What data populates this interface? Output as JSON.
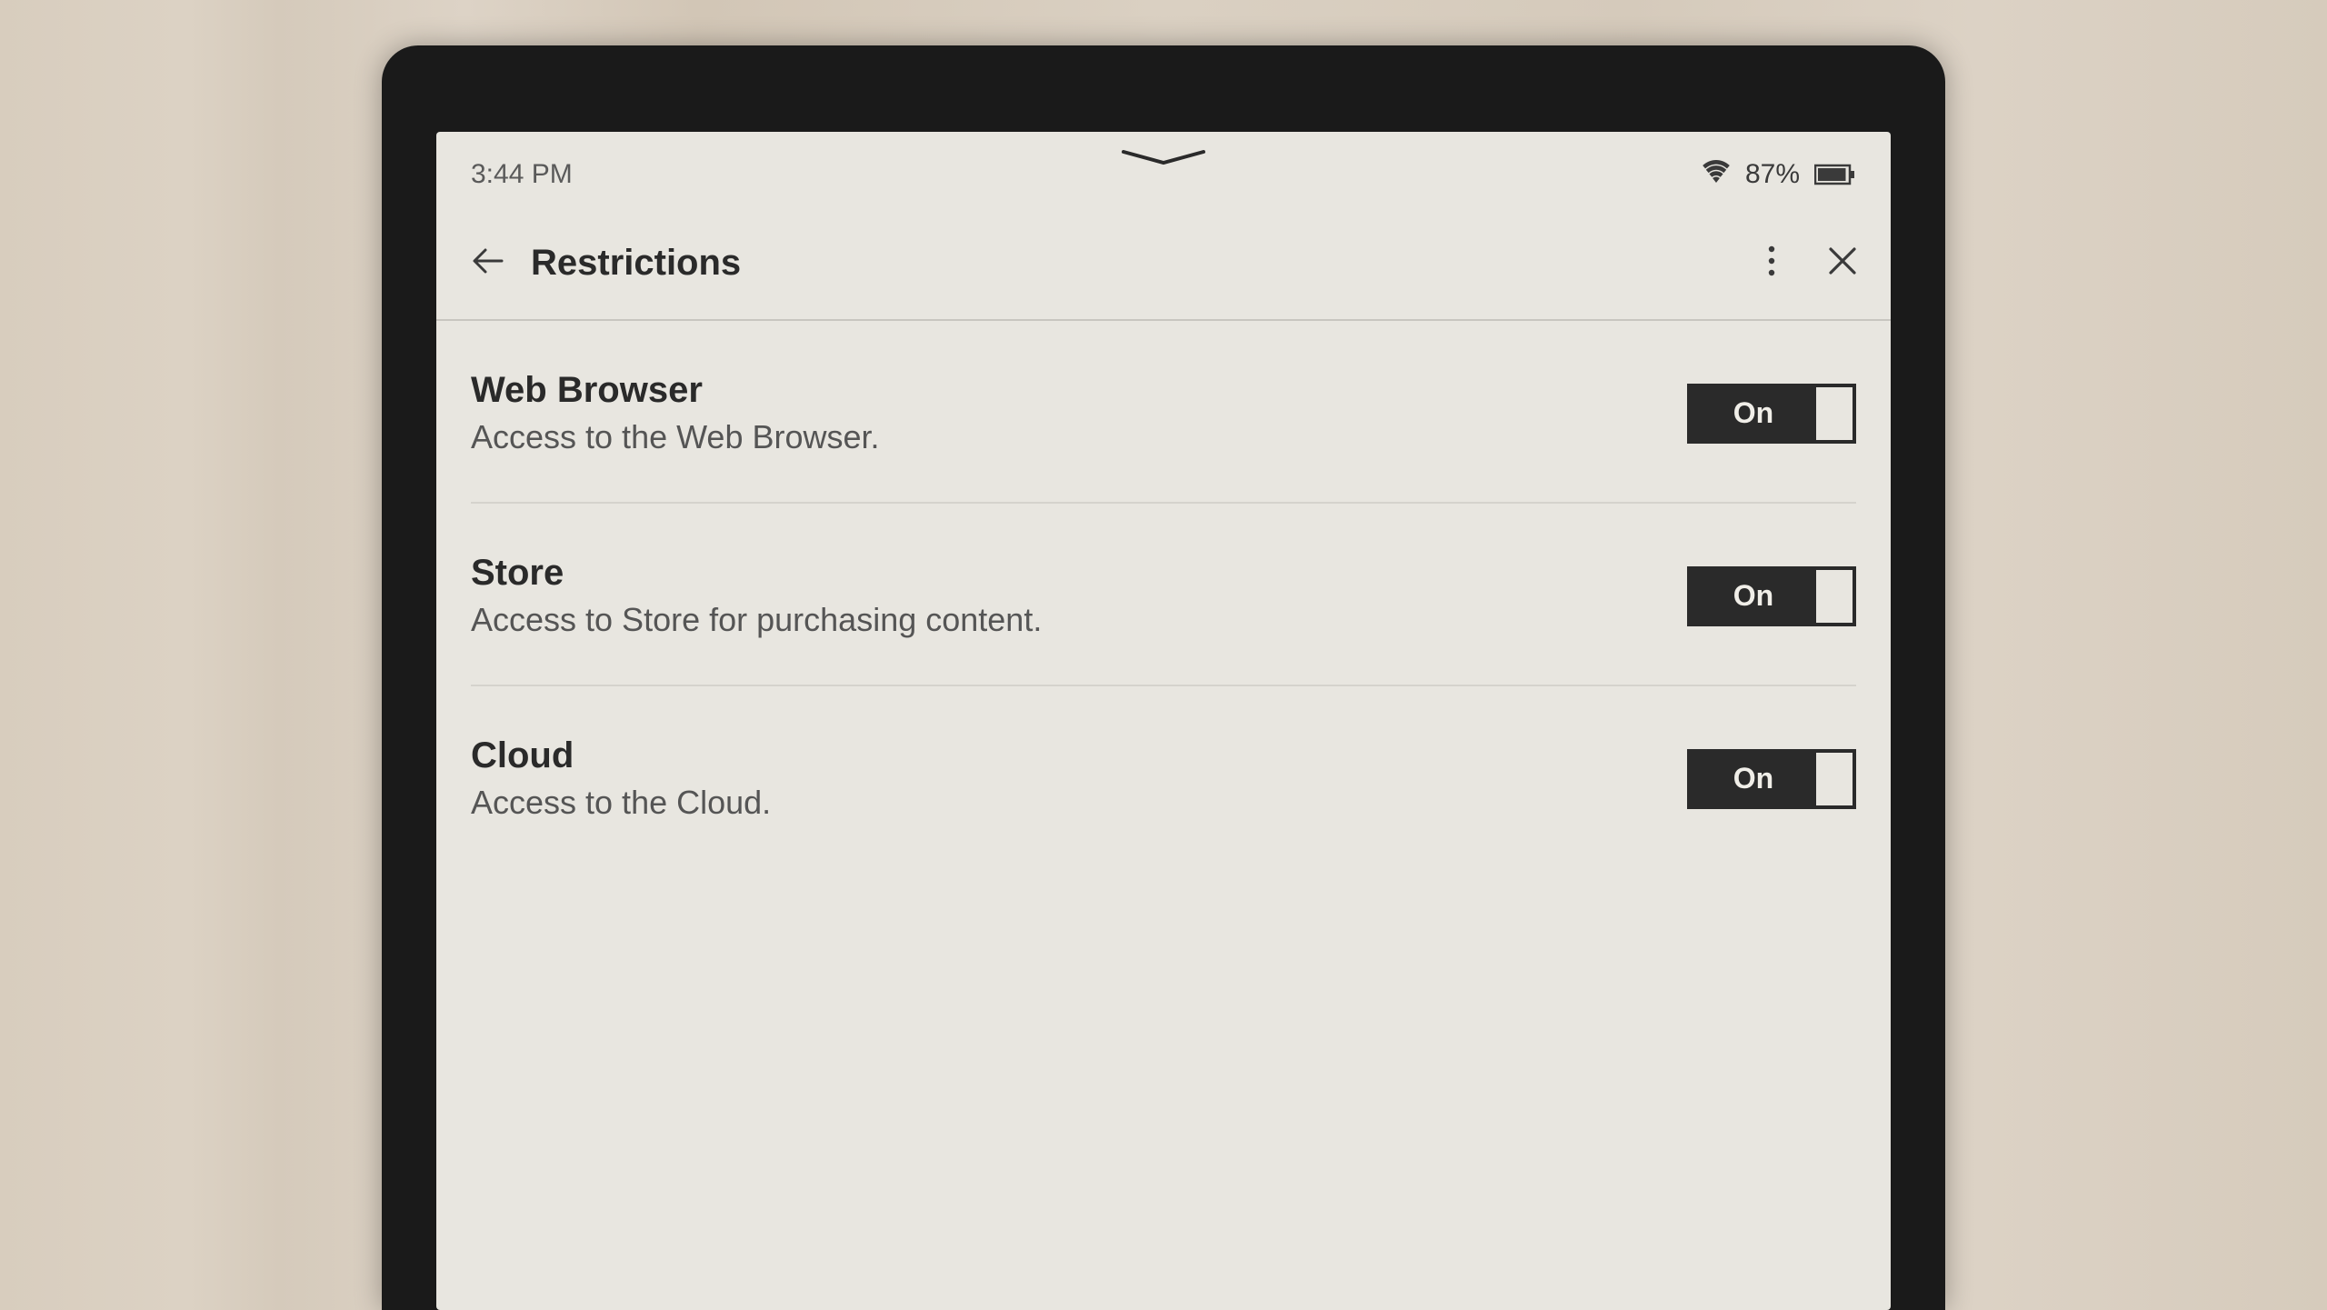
{
  "status": {
    "time": "3:44 PM",
    "battery_pct": "87%"
  },
  "appbar": {
    "title": "Restrictions"
  },
  "settings": [
    {
      "title": "Web Browser",
      "description": "Access to the Web Browser.",
      "toggle_label": "On"
    },
    {
      "title": "Store",
      "description": "Access to Store for purchasing content.",
      "toggle_label": "On"
    },
    {
      "title": "Cloud",
      "description": "Access to the Cloud.",
      "toggle_label": "On"
    }
  ]
}
